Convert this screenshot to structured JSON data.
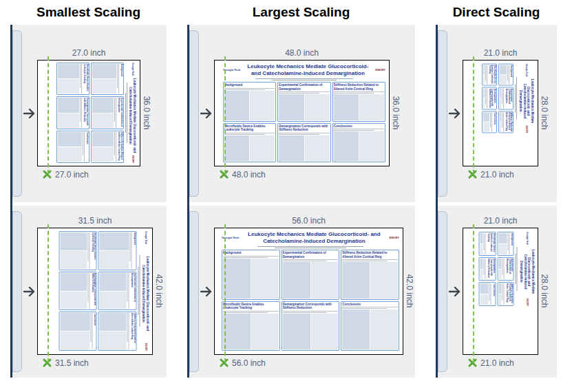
{
  "columns": [
    {
      "title": "Smallest Scaling",
      "panels": [
        {
          "width": "27.0 inch",
          "height": "36.0 inch",
          "bottom": "27.0 inch",
          "rotated": true
        },
        {
          "width": "31.5 inch",
          "height": "42.0 inch",
          "bottom": "31.5 inch",
          "rotated": true
        }
      ]
    },
    {
      "title": "Largest Scaling",
      "panels": [
        {
          "width": "48.0 inch",
          "height": "36.0 inch",
          "bottom": "48.0 inch",
          "rotated": false
        },
        {
          "width": "56.0 inch",
          "height": "42.0 inch",
          "bottom": "56.0 inch",
          "rotated": false
        }
      ]
    },
    {
      "title": "Direct Scaling",
      "panels": [
        {
          "width": "21.0 inch",
          "height": "28.0 inch",
          "bottom": "21.0 inch",
          "rotated": true
        },
        {
          "width": "21.0 inch",
          "height": "28.0 inch",
          "bottom": "21.0 inch",
          "rotated": true
        }
      ]
    }
  ],
  "poster": {
    "logo_left": "Georgia Tech",
    "logo_right": "EMORY",
    "title": "Leukocyte Mechanics Mediate Glucocorticoid- and Catecholamine-Induced Demargination",
    "columns": [
      [
        "Background",
        "Microfluidic Device Enables Leukocyte Tracking"
      ],
      [
        "Experimental Confirmation of Demargination",
        "Demargination Corresponds with Stiffness Reduction"
      ],
      [
        "Stiffness Reduction Related to Altered Actin Cortical Ring",
        "Conclusions"
      ]
    ]
  }
}
